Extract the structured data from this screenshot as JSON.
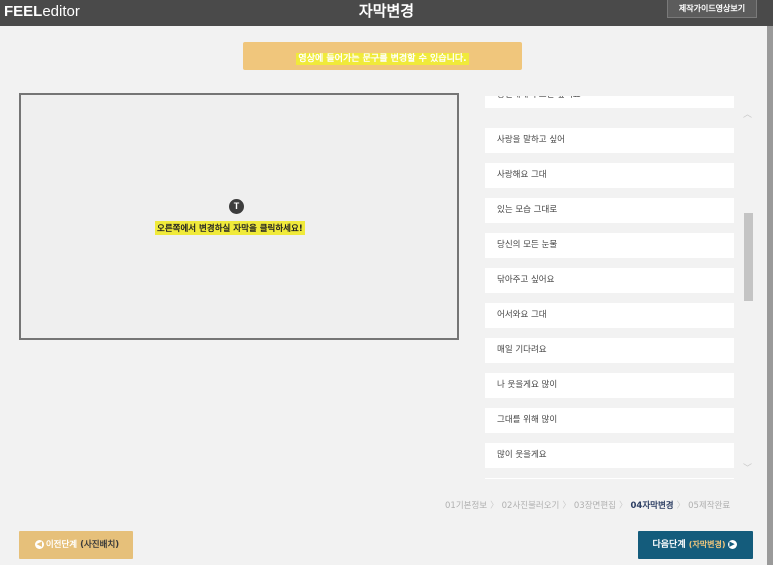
{
  "header": {
    "logo_bold": "FEEL",
    "logo_light": "editor",
    "title": "자막변경",
    "guide_button": "제작가이드영상보기"
  },
  "notice": {
    "text": "영상에 들어가는 문구를 변경할 수 있습니다."
  },
  "preview": {
    "icon_label": "T",
    "hint": "오른쪽에서 변경하실 자막을 클릭하세요!"
  },
  "subtitles": [
    "당신에게 주고만 싶어요",
    "사랑을 말하고 싶어",
    "사랑해요 그대",
    "있는 모습 그대로",
    "당신의 모든 눈물",
    "닦아주고 싶어요",
    "어서와요 그대",
    "매일 기다려요",
    "나 웃을게요 많이",
    "그대를 위해 많이",
    "많이 웃을게요",
    ""
  ],
  "steps": {
    "items": [
      "01기본정보",
      "02사진불러오기",
      "03장면편집",
      "04자막변경",
      "05제작완료"
    ],
    "separator": "〉",
    "active_index": 3
  },
  "buttons": {
    "prev_label": "이전단계",
    "prev_paren": "(사진배치)",
    "next_label": "다음단계",
    "next_paren": "(자막변경)"
  },
  "scrollbar": {
    "up_arrow": "︿",
    "down_arrow": "﹀"
  },
  "colors": {
    "topbar": "#4a4a4a",
    "notice_bg": "#f0c67c",
    "highlight": "#f0ea3a",
    "next_button": "#145c7c",
    "prev_button": "#e6c07a",
    "active_step": "#2c3e63"
  }
}
